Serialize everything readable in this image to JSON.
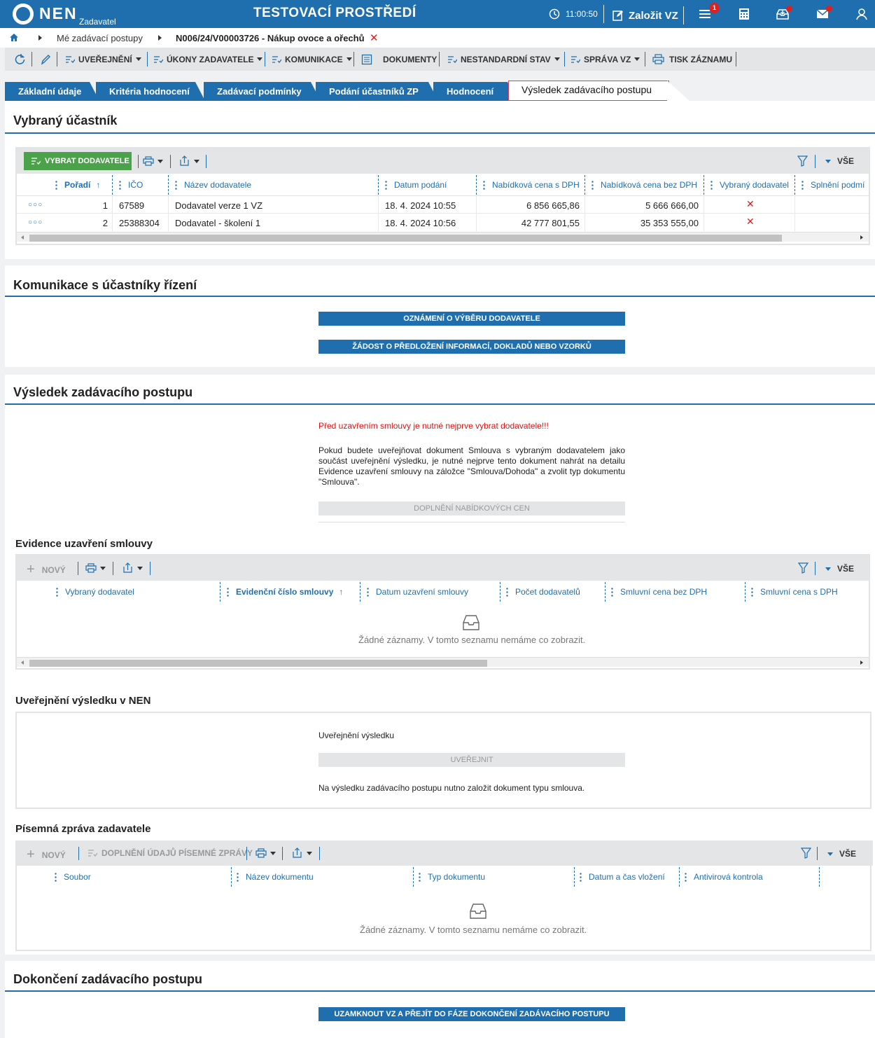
{
  "topbar": {
    "logo_text": "NEN",
    "logo_sub": "Zadavatel",
    "env_title": "TESTOVACÍ PROSTŘEDÍ",
    "clock": "11:00:50",
    "create_label": "Založit VZ",
    "notif_count": "1",
    "icons": [
      "clock-icon",
      "edit-icon",
      "menu-icon",
      "calculator-icon",
      "inbox-icon",
      "mail-icon",
      "user-icon"
    ]
  },
  "breadcrumb": {
    "level1": "Mé zadávací postupy",
    "level2": "N006/24/V00003726 - Nákup ovoce a ořechů"
  },
  "toolbar": {
    "publish": "UVEŘEJNĚNÍ",
    "acts": "ÚKONY ZADAVATELE",
    "communication": "KOMUNIKACE",
    "documents": "DOKUMENTY",
    "nonstandard": "NESTANDARDNÍ STAV",
    "management": "SPRÁVA VZ",
    "print": "TISK ZÁZNAMU"
  },
  "tabs": [
    {
      "label": "Základní údaje"
    },
    {
      "label": "Kritéria hodnocení"
    },
    {
      "label": "Zadávací podmínky"
    },
    {
      "label": "Podání účastníků ZP"
    },
    {
      "label": "Hodnocení"
    },
    {
      "label": "Výsledek zadávacího postupu"
    }
  ],
  "selected": {
    "title": "Vybraný účastník",
    "select_button": "VYBRAT DODAVATELE",
    "all_label": "VŠE",
    "columns": [
      "Pořadí",
      "IČO",
      "Název dodavatele",
      "Datum podání",
      "Nabídková cena s DPH",
      "Nabídková cena bez DPH",
      "Vybraný dodavatel",
      "Splnění podmí"
    ],
    "rows": [
      {
        "order": "1",
        "ico": "67589",
        "name": "Dodavatel verze 1 VZ",
        "date": "18. 4. 2024 10:55",
        "price_vat": "6 856 665,86",
        "price_novat": "5 666 666,00"
      },
      {
        "order": "2",
        "ico": "25388304",
        "name": "Dodavatel - školení 1",
        "date": "18. 4. 2024 10:56",
        "price_vat": "42 777 801,55",
        "price_novat": "35 353 555,00"
      }
    ]
  },
  "communication": {
    "title": "Komunikace s účastníky řízení",
    "btn1": "OZNÁMENÍ O VÝBĚRU DODAVATELE",
    "btn2": "ŽÁDOST O PŘEDLOŽENÍ INFORMACÍ, DOKLADŮ NEBO VZORKŮ"
  },
  "result": {
    "title": "Výsledek zadávacího postupu",
    "warning": "Před uzavřením smlouvy je nutné nejprve vybrat dodavatele!!!",
    "info": "Pokud budete uveřejňovat dokument Smlouva s vybraným dodavatelem jako součást uveřejnění výsledku, je nutné nejprve tento dokument nahrát na detailu Evidence uzavření smlouvy na záložce \"Smlouva/Dohoda\" a zvolit typ dokumentu \"Smlouva\".",
    "price_button": "DOPLNĚNÍ NABÍDKOVÝCH CEN"
  },
  "contracts": {
    "title": "Evidence uzavření smlouvy",
    "new_label": "NOVÝ",
    "all_label": "VŠE",
    "columns": [
      "Vybraný dodavatel",
      "Evidenční číslo smlouvy",
      "Datum uzavření smlouvy",
      "Počet dodavatelů",
      "Smluvní cena bez DPH",
      "Smluvní cena s DPH"
    ],
    "empty": "Žádné záznamy. V tomto seznamu nemáme co zobrazit."
  },
  "publication": {
    "title": "Uveřejnění výsledku v NEN",
    "label": "Uveřejnění výsledku",
    "button": "UVEŘEJNIT",
    "note": "Na výsledku zadávacího postupu nutno založit dokument typu smlouva."
  },
  "report": {
    "title": "Písemná zpráva zadavatele",
    "new_label": "NOVÝ",
    "fill_label": "DOPLNĚNÍ ÚDAJŮ PÍSEMNÉ ZPRÁVY",
    "all_label": "VŠE",
    "columns": [
      "Soubor",
      "Název dokumentu",
      "Typ dokumentu",
      "Datum a čas vložení",
      "Antivirová kontrola"
    ],
    "empty": "Žádné záznamy. V tomto seznamu nemáme co zobrazit."
  },
  "completion": {
    "title": "Dokončení zadávacího postupu",
    "button": "UZAMKNOUT VZ A PŘEJÍT DO FÁZE DOKONČENÍ ZADÁVACÍHO POSTUPU"
  },
  "colors": {
    "brand": "#1f6fae",
    "success": "#4ba24b",
    "danger": "#e01010"
  }
}
